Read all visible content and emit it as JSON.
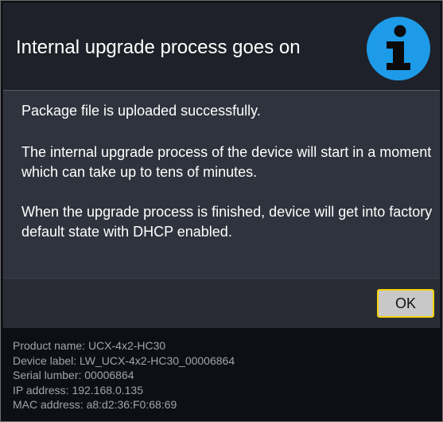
{
  "dialog": {
    "title": "Internal upgrade process goes on",
    "icon": "info-icon",
    "message_1": "Package file is uploaded successfully.",
    "message_2": "The internal upgrade process of the device will start in a moment which can take up to tens of minutes.",
    "message_3": "When the upgrade process is finished, device will get into factory default state with DHCP enabled.",
    "ok_label": "OK"
  },
  "device_info": {
    "product_name": "Product name: UCX-4x2-HC30",
    "device_label": "Device label: LW_UCX-4x2-HC30_00006864",
    "serial_number": "Serial lumber: 00006864",
    "ip_address": "IP address: 192.168.0.135",
    "mac_address": "MAC address: a8:d2:36:F0:68:69"
  },
  "colors": {
    "info_icon": "#1e9be8",
    "ok_border": "#f2d20a",
    "background": "#0d0f14"
  }
}
